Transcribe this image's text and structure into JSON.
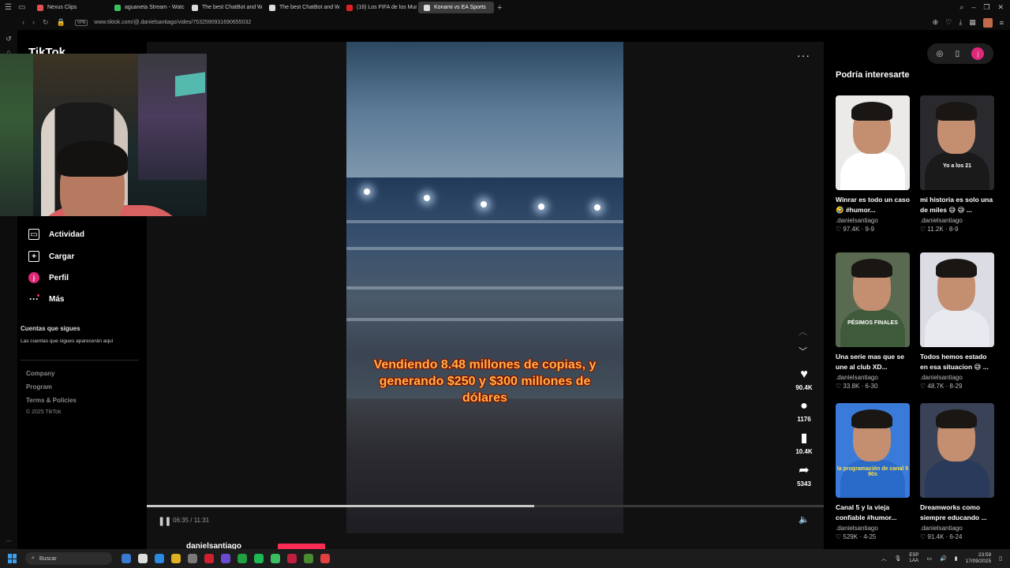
{
  "browser": {
    "tabs": [
      {
        "label": "Nexus Clips",
        "color": "#e05050",
        "active": false
      },
      {
        "label": "aguaneta Stream - Watch",
        "color": "#3ac060",
        "active": false
      },
      {
        "label": "The best ChatBot and W",
        "color": "#dddddd",
        "active": false
      },
      {
        "label": "The best ChatBot and W",
        "color": "#dddddd",
        "active": false
      },
      {
        "label": "(16) Los FIFA de los Mun",
        "color": "#e02020",
        "active": false
      },
      {
        "label": "Konami vs EA Sports",
        "color": "#dddddd",
        "active": true
      }
    ],
    "vpn_label": "VPN",
    "url": "www.tiktok.com/@.danielsantiago/video/7532590931690655032"
  },
  "tiktok_nav": {
    "logo": "TikTok",
    "items": [
      {
        "label": "Actividad",
        "icon": "activity-icon"
      },
      {
        "label": "Cargar",
        "icon": "upload-icon"
      },
      {
        "label": "Perfil",
        "icon": "profile-icon",
        "avatar_letter": "j"
      },
      {
        "label": "Más",
        "icon": "more-icon"
      }
    ],
    "following_title": "Cuentas que sigues",
    "following_text": "Las cuentas que sigues aparecerán aquí",
    "footer": [
      "Company",
      "Program",
      "Terms & Policies"
    ],
    "copyright": "© 2025 TikTok"
  },
  "video": {
    "caption": "Vendiendo 8.48 millones de copias, y generando $250 y $300 millones de dólares",
    "time": "06:35 / 11:31",
    "progress": 0.572,
    "likes": "90.4K",
    "comments": "1176",
    "saves": "10.4K",
    "shares": "5343",
    "author": "danielsantiago"
  },
  "right_panel": {
    "title": "Podría interesarte",
    "avatar_letter": "j",
    "cards": [
      {
        "title": "Winrar es todo un caso 🤣 #humor...",
        "author": ".danielsantiago",
        "likes": "97.4K",
        "date": "9-9",
        "thumb_text": "",
        "shirt": "#ffffff"
      },
      {
        "title": "mi historia es solo una de miles 😅 😅 ...",
        "author": ".danielsantiago",
        "likes": "11.2K",
        "date": "8-9",
        "thumb_text": "Yo a los 21",
        "shirt": "#1a1a1a"
      },
      {
        "title": "Una serie mas que se une al club XD...",
        "author": ".danielsantiago",
        "likes": "33.8K",
        "date": "6-30",
        "thumb_text": "PÉSIMOS FINALES",
        "shirt": "#3f5a3a"
      },
      {
        "title": "Todos hemos estado en esa situacion 😅 ...",
        "author": ".danielsantiago",
        "likes": "48.7K",
        "date": "8-29",
        "thumb_text": "",
        "shirt": "#e8eaf0"
      },
      {
        "title": "Canal 5 y la vieja confiable #humor...",
        "author": ".danielsantiago",
        "likes": "529K",
        "date": "4-25",
        "thumb_text": "la programación de canal 5 90s",
        "shirt": "#2a6ac8"
      },
      {
        "title": "Dreamworks como siempre educando ...",
        "author": ".danielsantiago",
        "likes": "91.4K",
        "date": "6-24",
        "thumb_text": "",
        "shirt": "#2a3a5a"
      }
    ]
  },
  "taskbar": {
    "search_placeholder": "Buscar",
    "lang_top": "ESP",
    "lang_bottom": "LAA",
    "time": "23:59",
    "date": "17/09/2025"
  }
}
